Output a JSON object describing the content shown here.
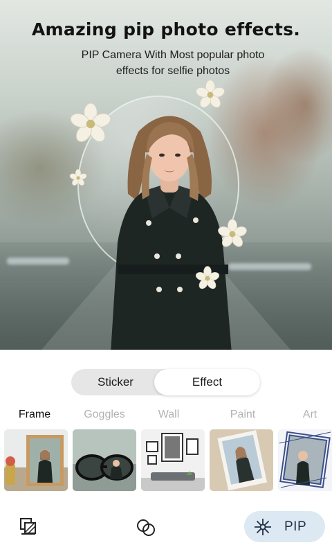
{
  "hero": {
    "title": "Amazing pip photo effects.",
    "subtitle": "PIP Camera With Most popular photo effects for selfie photos"
  },
  "segment": {
    "sticker_label": "Sticker",
    "effect_label": "Effect",
    "selected": "Effect"
  },
  "categories": {
    "active": "Frame",
    "items": [
      {
        "label": "Frame"
      },
      {
        "label": "Goggles"
      },
      {
        "label": "Wall"
      },
      {
        "label": "Paint"
      },
      {
        "label": "Art"
      }
    ]
  },
  "thumbnails": [
    {
      "icon": "photo-frame-thumbnail"
    },
    {
      "icon": "goggles-thumbnail"
    },
    {
      "icon": "wall-gallery-thumbnail"
    },
    {
      "icon": "paint-canvas-thumbnail"
    },
    {
      "icon": "art-frame-thumbnail"
    }
  ],
  "toolbar": {
    "gallery_icon": "layers-icon",
    "effects_icon": "overlap-circles-icon",
    "pip_label": "PIP",
    "pip_icon": "snowflake-icon"
  },
  "colors": {
    "pip_button_bg": "#dce9f3",
    "segment_bg": "#e6e6e6",
    "active_tab": "#111111",
    "inactive_tab": "#b3b3b3"
  }
}
